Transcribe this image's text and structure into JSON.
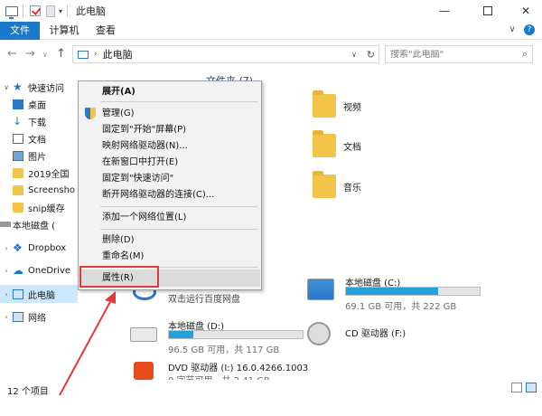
{
  "window": {
    "title": "此电脑"
  },
  "ribbon": {
    "tabs": [
      "文件",
      "计算机",
      "查看"
    ],
    "chevron": "∨"
  },
  "address": {
    "path": "此电脑",
    "search_placeholder": "搜索\"此电脑\""
  },
  "sidebar": {
    "items": [
      {
        "label": "快速访问",
        "icon": "star-icon",
        "expanded": true
      },
      {
        "label": "桌面",
        "icon": "desktop-icon"
      },
      {
        "label": "下载",
        "icon": "download-icon"
      },
      {
        "label": "文档",
        "icon": "documents-icon"
      },
      {
        "label": "图片",
        "icon": "pictures-icon"
      },
      {
        "label": "2019全国",
        "icon": "folder-icon"
      },
      {
        "label": "Screensho",
        "icon": "folder-icon"
      },
      {
        "label": "snip缓存",
        "icon": "folder-icon"
      },
      {
        "label": "本地磁盘 (",
        "icon": "drive-icon"
      },
      {
        "label": "Dropbox",
        "icon": "dropbox-icon"
      },
      {
        "label": "OneDrive",
        "icon": "onedrive-icon"
      },
      {
        "label": "此电脑",
        "icon": "computer-icon",
        "selected": true
      },
      {
        "label": "网络",
        "icon": "network-icon"
      }
    ]
  },
  "main": {
    "group_header": "文件夹 (7)",
    "folders": [
      {
        "label": "视频"
      },
      {
        "label": "文档"
      },
      {
        "label": "音乐"
      }
    ],
    "drives": [
      {
        "name": "双击运行百度网盘",
        "info": ""
      },
      {
        "name": "本地磁盘 (C:)",
        "info": "69.1 GB 可用，共 222 GB",
        "used_fraction": 0.69
      },
      {
        "name": "本地磁盘 (D:)",
        "info": "96.5 GB 可用，共 117 GB",
        "used_fraction": 0.18
      },
      {
        "name": "CD 驱动器 (F:)",
        "info": ""
      },
      {
        "name": "DVD 驱动器 (I:) 16.0.4266.1003",
        "info": "0 字节可用，共 2.41 GB"
      }
    ]
  },
  "context_menu": {
    "items": [
      {
        "label": "展开(A)",
        "bold": true
      },
      {
        "label": "管理(G)",
        "icon": "shield-icon"
      },
      {
        "label": "固定到\"开始\"屏幕(P)"
      },
      {
        "label": "映射网络驱动器(N)..."
      },
      {
        "label": "在新窗口中打开(E)"
      },
      {
        "label": "固定到\"快速访问\""
      },
      {
        "label": "断开网络驱动器的连接(C)..."
      },
      {
        "label": "添加一个网络位置(L)"
      },
      {
        "label": "删除(D)"
      },
      {
        "label": "重命名(M)"
      },
      {
        "label": "属性(R)",
        "highlighted": true
      }
    ]
  },
  "status": {
    "item_count": "12 个项目"
  },
  "colors": {
    "accent": "#1979ca",
    "annotation": "#e23a3a",
    "drive_bar": "#26a0da"
  }
}
